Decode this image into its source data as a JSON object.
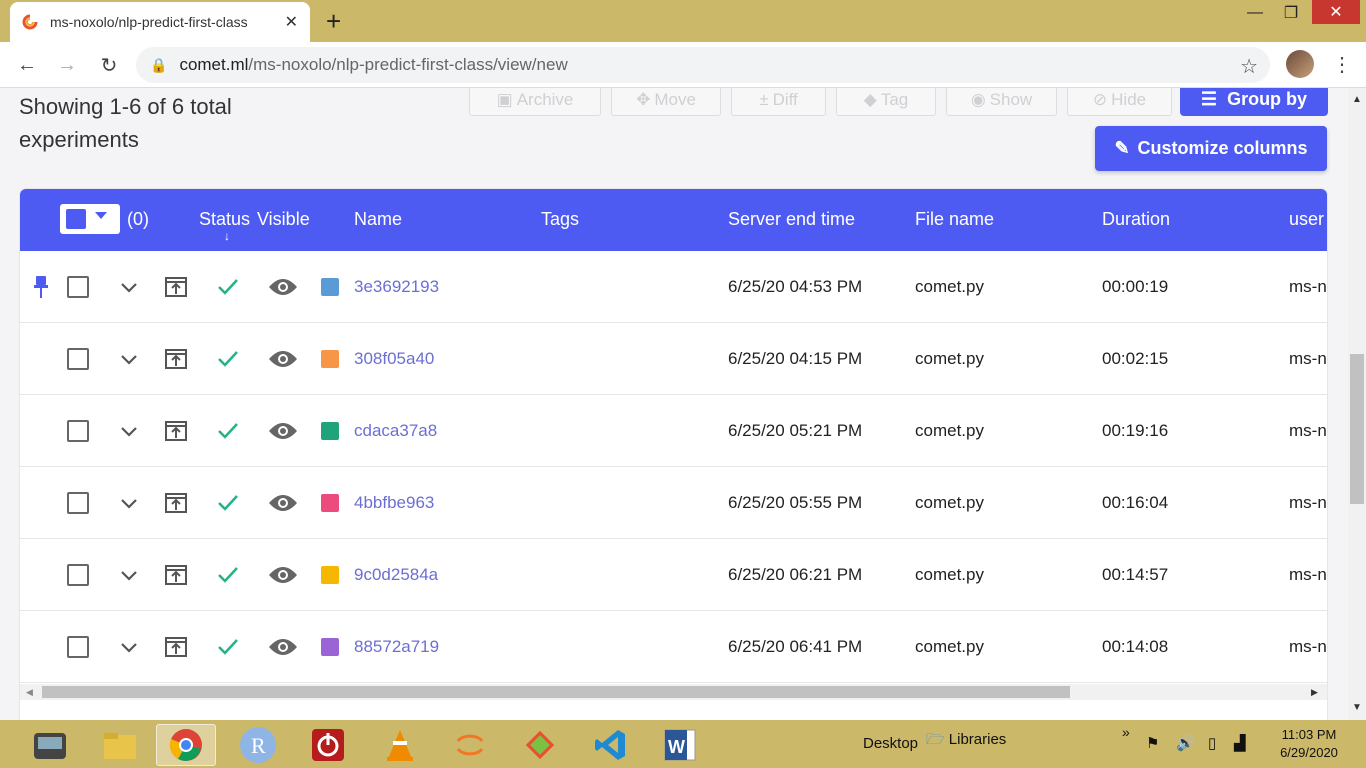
{
  "browser": {
    "tab_title": "ms-noxolo/nlp-predict-first-class",
    "url_host": "comet.ml",
    "url_path": "/ms-noxolo/nlp-predict-first-class/view/new"
  },
  "header": {
    "showing": "Showing 1-6 of 6 total experiments",
    "toolbar": {
      "archive": "Archive",
      "move": "Move",
      "diff": "Diff",
      "tag": "Tag",
      "show": "Show",
      "hide": "Hide",
      "group_by": "Group by",
      "customize_columns": "Customize columns"
    }
  },
  "table": {
    "selected_count": "(0)",
    "columns": {
      "status": "Status",
      "visible": "Visible",
      "name": "Name",
      "tags": "Tags",
      "server_end_time": "Server end time",
      "file_name": "File name",
      "duration": "Duration",
      "user": "user"
    },
    "rows": [
      {
        "name": "3e3692193",
        "color": "#5b9bd5",
        "end_time": "6/25/20 04:53 PM",
        "file": "comet.py",
        "duration": "00:00:19",
        "user": "ms-n",
        "pinned": true
      },
      {
        "name": "308f05a40",
        "color": "#f79646",
        "end_time": "6/25/20 04:15 PM",
        "file": "comet.py",
        "duration": "00:02:15",
        "user": "ms-n",
        "pinned": false
      },
      {
        "name": "cdaca37a8",
        "color": "#1ea37a",
        "end_time": "6/25/20 05:21 PM",
        "file": "comet.py",
        "duration": "00:19:16",
        "user": "ms-n",
        "pinned": false
      },
      {
        "name": "4bbfbe963",
        "color": "#ec4b7e",
        "end_time": "6/25/20 05:55 PM",
        "file": "comet.py",
        "duration": "00:16:04",
        "user": "ms-n",
        "pinned": false
      },
      {
        "name": "9c0d2584a",
        "color": "#f5b800",
        "end_time": "6/25/20 06:21 PM",
        "file": "comet.py",
        "duration": "00:14:57",
        "user": "ms-n",
        "pinned": false
      },
      {
        "name": "88572a719",
        "color": "#9a63d6",
        "end_time": "6/25/20 06:41 PM",
        "file": "comet.py",
        "duration": "00:14:08",
        "user": "ms-n",
        "pinned": false
      }
    ]
  },
  "taskbar": {
    "desktop": "Desktop",
    "libraries": "Libraries",
    "time": "11:03 PM",
    "date": "6/29/2020"
  },
  "colors": {
    "accent": "#4d5bf3",
    "link": "#6b6fd4",
    "check": "#1fb58a"
  }
}
